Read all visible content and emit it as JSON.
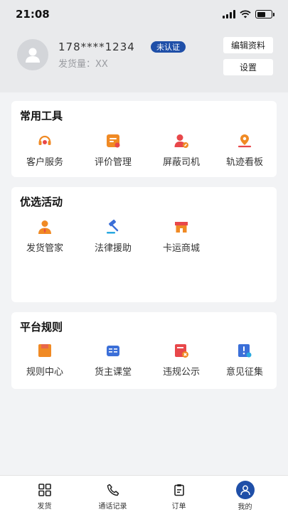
{
  "status_bar": {
    "time": "21:08"
  },
  "profile": {
    "phone": "178****1234",
    "verify_badge": "未认证",
    "ship_count": "发货量：XX",
    "edit_button": "编辑资料",
    "settings_button": "设置"
  },
  "sections": {
    "tools": {
      "title": "常用工具",
      "items": [
        {
          "label": "客户服务",
          "icon": "headset-icon"
        },
        {
          "label": "评价管理",
          "icon": "review-icon"
        },
        {
          "label": "屏蔽司机",
          "icon": "block-driver-icon"
        },
        {
          "label": "轨迹看板",
          "icon": "track-icon"
        }
      ]
    },
    "activities": {
      "title": "优选活动",
      "items": [
        {
          "label": "发货管家",
          "icon": "butler-icon"
        },
        {
          "label": "法律援助",
          "icon": "gavel-icon"
        },
        {
          "label": "卡运商城",
          "icon": "store-icon"
        }
      ]
    },
    "rules": {
      "title": "平台规则",
      "items": [
        {
          "label": "规则中心",
          "icon": "rules-icon"
        },
        {
          "label": "货主课堂",
          "icon": "book-icon"
        },
        {
          "label": "违规公示",
          "icon": "violation-icon"
        },
        {
          "label": "意见征集",
          "icon": "feedback-icon"
        }
      ]
    }
  },
  "tabbar": {
    "items": [
      {
        "label": "发货",
        "icon": "grid-icon"
      },
      {
        "label": "通话记录",
        "icon": "phone-icon"
      },
      {
        "label": "订单",
        "icon": "clipboard-icon"
      },
      {
        "label": "我的",
        "icon": "user-icon",
        "active": true
      }
    ]
  },
  "colors": {
    "accent": "#1f4fa8",
    "orange": "#f08a24",
    "red": "#e8474a",
    "blue": "#3b6fd8"
  }
}
